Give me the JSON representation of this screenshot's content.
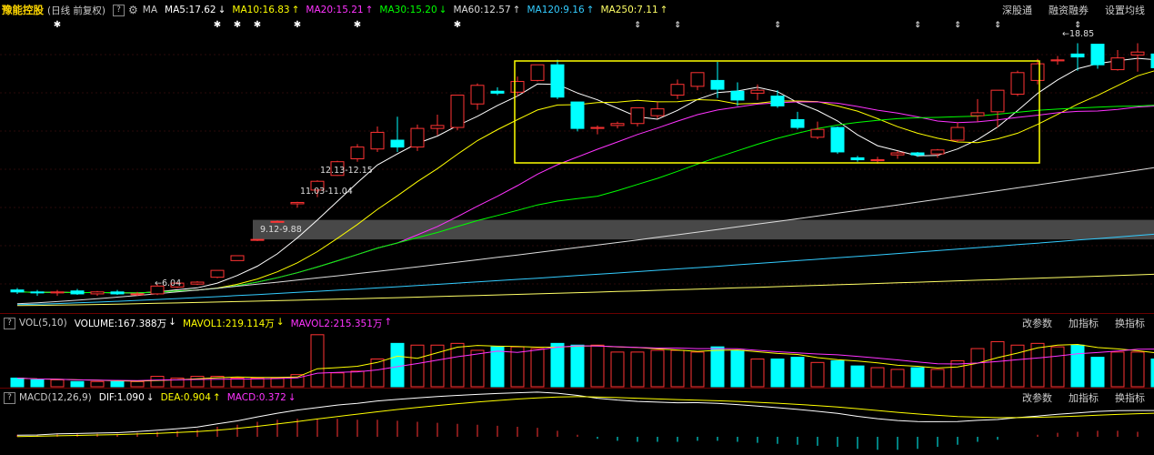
{
  "header": {
    "stock_name": "豫能控股",
    "period_label": "(日线 前复权)",
    "help_icon": "?",
    "settings_icon": "gear-icon",
    "ma_label": "MA",
    "indicators": [
      {
        "text": "MA5:17.62",
        "arrow": "↓",
        "color": "#ffffff"
      },
      {
        "text": "MA10:16.83",
        "arrow": "↑",
        "color": "#ffff00"
      },
      {
        "text": "MA20:15.21",
        "arrow": "↑",
        "color": "#ff33ff"
      },
      {
        "text": "MA30:15.20",
        "arrow": "↓",
        "color": "#00ff00"
      },
      {
        "text": "MA60:12.57",
        "arrow": "↑",
        "color": "#dddddd"
      },
      {
        "text": "MA120:9.16",
        "arrow": "↑",
        "color": "#33ccff"
      },
      {
        "text": "MA250:7.11",
        "arrow": "↑",
        "color": "#ffff66"
      }
    ],
    "right_buttons": [
      "深股通",
      "融资融券",
      "设置均线"
    ]
  },
  "volume_panel": {
    "help_icon": "?",
    "title": "VOL(5,10)",
    "items": [
      {
        "text": "VOLUME:167.388万",
        "arrow": "↓",
        "color": "#ffffff"
      },
      {
        "text": "MAVOL1:219.114万",
        "arrow": "↓",
        "color": "#ffff00"
      },
      {
        "text": "MAVOL2:215.351万",
        "arrow": "↑",
        "color": "#ff33ff"
      }
    ],
    "right_buttons": [
      "改参数",
      "加指标",
      "换指标"
    ]
  },
  "macd_panel": {
    "help_icon": "?",
    "title": "MACD(12,26,9)",
    "items": [
      {
        "text": "DIF:1.090",
        "arrow": "↓",
        "color": "#ffffff"
      },
      {
        "text": "DEA:0.904",
        "arrow": "↑",
        "color": "#ffff00"
      },
      {
        "text": "MACD:0.372",
        "arrow": "↓",
        "color": "#ff33ff"
      }
    ],
    "right_buttons": [
      "改参数",
      "加指标",
      "换指标"
    ]
  },
  "colors": {
    "up": "#ff3333",
    "down": "#00ffff",
    "highlight_box": "#ffff00",
    "range_band": "#555555"
  },
  "annotations": [
    {
      "label": "6.04",
      "type": "low"
    },
    {
      "label": "9.12-9.88",
      "type": "range"
    },
    {
      "label": "11.03-11.04",
      "type": "range"
    },
    {
      "label": "12.13-12.15",
      "type": "range"
    },
    {
      "label": "18.85",
      "type": "high"
    }
  ],
  "markers": {
    "asterisk_candles": [
      2,
      10,
      11,
      12,
      14,
      17,
      22
    ],
    "dagger_candles": [
      31,
      33,
      38,
      45,
      47,
      49,
      53
    ],
    "asterisk_glyph": "✱",
    "dagger_glyph": "⇕"
  },
  "chart_data": {
    "type": "candlestick",
    "ylim": [
      5.4,
      19.9
    ],
    "candles": [
      {
        "o": 6.3,
        "h": 6.4,
        "l": 6.1,
        "c": 6.2
      },
      {
        "o": 6.2,
        "h": 6.3,
        "l": 6.0,
        "c": 6.15
      },
      {
        "o": 6.15,
        "h": 6.3,
        "l": 6.0,
        "c": 6.2
      },
      {
        "o": 6.25,
        "h": 6.35,
        "l": 6.05,
        "c": 6.1
      },
      {
        "o": 6.1,
        "h": 6.25,
        "l": 6.0,
        "c": 6.2
      },
      {
        "o": 6.2,
        "h": 6.3,
        "l": 6.05,
        "c": 6.1
      },
      {
        "o": 6.1,
        "h": 6.2,
        "l": 6.0,
        "c": 6.1
      },
      {
        "o": 6.1,
        "h": 6.6,
        "l": 6.04,
        "c": 6.5
      },
      {
        "o": 6.45,
        "h": 6.7,
        "l": 6.4,
        "c": 6.65
      },
      {
        "o": 6.6,
        "h": 6.75,
        "l": 6.55,
        "c": 6.7
      },
      {
        "o": 6.95,
        "h": 7.3,
        "l": 6.9,
        "c": 7.3
      },
      {
        "o": 7.8,
        "h": 8.05,
        "l": 7.8,
        "c": 8.05
      },
      {
        "o": 8.85,
        "h": 8.88,
        "l": 8.8,
        "c": 8.88
      },
      {
        "o": 9.78,
        "h": 9.85,
        "l": 9.76,
        "c": 9.8
      },
      {
        "o": 10.7,
        "h": 10.8,
        "l": 10.5,
        "c": 10.77
      },
      {
        "o": 11.4,
        "h": 11.9,
        "l": 11.04,
        "c": 11.85
      },
      {
        "o": 12.15,
        "h": 12.9,
        "l": 12.13,
        "c": 12.85
      },
      {
        "o": 13.0,
        "h": 13.75,
        "l": 12.85,
        "c": 13.6
      },
      {
        "o": 13.5,
        "h": 14.65,
        "l": 13.35,
        "c": 14.35
      },
      {
        "o": 13.95,
        "h": 15.15,
        "l": 13.35,
        "c": 13.6
      },
      {
        "o": 13.6,
        "h": 14.75,
        "l": 13.4,
        "c": 14.55
      },
      {
        "o": 14.55,
        "h": 15.25,
        "l": 14.2,
        "c": 14.7
      },
      {
        "o": 14.6,
        "h": 16.25,
        "l": 14.45,
        "c": 16.25
      },
      {
        "o": 15.8,
        "h": 16.85,
        "l": 15.5,
        "c": 16.75
      },
      {
        "o": 16.45,
        "h": 16.65,
        "l": 16.25,
        "c": 16.35
      },
      {
        "o": 16.4,
        "h": 17.2,
        "l": 16.2,
        "c": 16.95
      },
      {
        "o": 17.0,
        "h": 17.8,
        "l": 16.95,
        "c": 17.8
      },
      {
        "o": 17.8,
        "h": 18.05,
        "l": 16.05,
        "c": 16.15
      },
      {
        "o": 15.9,
        "h": 15.9,
        "l": 14.4,
        "c": 14.55
      },
      {
        "o": 14.55,
        "h": 14.7,
        "l": 14.25,
        "c": 14.6
      },
      {
        "o": 14.7,
        "h": 14.9,
        "l": 14.55,
        "c": 14.8
      },
      {
        "o": 14.8,
        "h": 15.6,
        "l": 14.65,
        "c": 15.6
      },
      {
        "o": 15.2,
        "h": 15.9,
        "l": 15.05,
        "c": 15.55
      },
      {
        "o": 16.25,
        "h": 17.05,
        "l": 16.05,
        "c": 16.8
      },
      {
        "o": 16.7,
        "h": 17.4,
        "l": 16.5,
        "c": 17.4
      },
      {
        "o": 17.0,
        "h": 17.95,
        "l": 16.1,
        "c": 16.55
      },
      {
        "o": 16.45,
        "h": 16.9,
        "l": 15.7,
        "c": 16.0
      },
      {
        "o": 16.35,
        "h": 16.8,
        "l": 16.0,
        "c": 16.5
      },
      {
        "o": 16.2,
        "h": 16.5,
        "l": 15.6,
        "c": 15.7
      },
      {
        "o": 15.0,
        "h": 15.4,
        "l": 14.5,
        "c": 14.6
      },
      {
        "o": 14.1,
        "h": 14.9,
        "l": 14.0,
        "c": 14.5
      },
      {
        "o": 14.6,
        "h": 14.65,
        "l": 13.25,
        "c": 13.35
      },
      {
        "o": 13.05,
        "h": 13.15,
        "l": 12.85,
        "c": 12.95
      },
      {
        "o": 12.9,
        "h": 13.1,
        "l": 12.75,
        "c": 12.95
      },
      {
        "o": 13.2,
        "h": 13.4,
        "l": 13.0,
        "c": 13.3
      },
      {
        "o": 13.3,
        "h": 13.35,
        "l": 13.1,
        "c": 13.2
      },
      {
        "o": 13.25,
        "h": 13.5,
        "l": 13.05,
        "c": 13.45
      },
      {
        "o": 13.95,
        "h": 14.85,
        "l": 13.85,
        "c": 14.6
      },
      {
        "o": 15.2,
        "h": 16.05,
        "l": 14.9,
        "c": 15.35
      },
      {
        "o": 15.4,
        "h": 16.5,
        "l": 14.6,
        "c": 16.5
      },
      {
        "o": 16.3,
        "h": 17.5,
        "l": 16.2,
        "c": 17.4
      },
      {
        "o": 17.0,
        "h": 18.1,
        "l": 16.8,
        "c": 17.85
      },
      {
        "o": 18.0,
        "h": 18.25,
        "l": 17.8,
        "c": 18.05
      },
      {
        "o": 18.35,
        "h": 18.9,
        "l": 17.5,
        "c": 18.2
      },
      {
        "o": 18.85,
        "h": 18.85,
        "l": 17.6,
        "c": 17.8
      },
      {
        "o": 17.55,
        "h": 18.55,
        "l": 17.5,
        "c": 18.15
      },
      {
        "o": 18.3,
        "h": 18.9,
        "l": 17.45,
        "c": 18.45
      },
      {
        "o": 18.35,
        "h": 18.5,
        "l": 17.35,
        "c": 17.65
      }
    ],
    "volume": [
      0.5,
      0.4,
      0.4,
      0.3,
      0.3,
      0.3,
      0.3,
      0.6,
      0.5,
      0.6,
      0.6,
      0.5,
      0.5,
      0.5,
      0.7,
      3.0,
      0.8,
      0.9,
      1.6,
      2.5,
      2.4,
      2.4,
      2.5,
      2.1,
      2.3,
      2.3,
      2.2,
      2.5,
      2.4,
      2.4,
      2.0,
      2.0,
      2.1,
      2.1,
      2.0,
      2.3,
      2.1,
      1.6,
      1.6,
      1.7,
      1.4,
      1.5,
      1.2,
      1.1,
      1.0,
      1.1,
      1.0,
      1.5,
      2.2,
      2.6,
      2.4,
      2.5,
      2.3,
      2.4,
      1.7,
      2.0,
      2.0,
      1.6
    ],
    "macd_bars": [
      0.02,
      0.02,
      0.03,
      0.03,
      0.03,
      0.03,
      0.04,
      0.05,
      0.06,
      0.07,
      0.1,
      0.12,
      0.15,
      0.17,
      0.18,
      0.18,
      0.18,
      0.17,
      0.17,
      0.16,
      0.15,
      0.14,
      0.13,
      0.12,
      0.11,
      0.1,
      0.09,
      0.06,
      0.02,
      -0.02,
      -0.04,
      -0.05,
      -0.05,
      -0.05,
      -0.04,
      -0.04,
      -0.05,
      -0.06,
      -0.07,
      -0.08,
      -0.09,
      -0.1,
      -0.12,
      -0.13,
      -0.13,
      -0.12,
      -0.1,
      -0.08,
      -0.05,
      -0.03,
      0.0,
      0.02,
      0.04,
      0.05,
      0.06,
      0.06,
      0.05,
      0.04
    ]
  }
}
